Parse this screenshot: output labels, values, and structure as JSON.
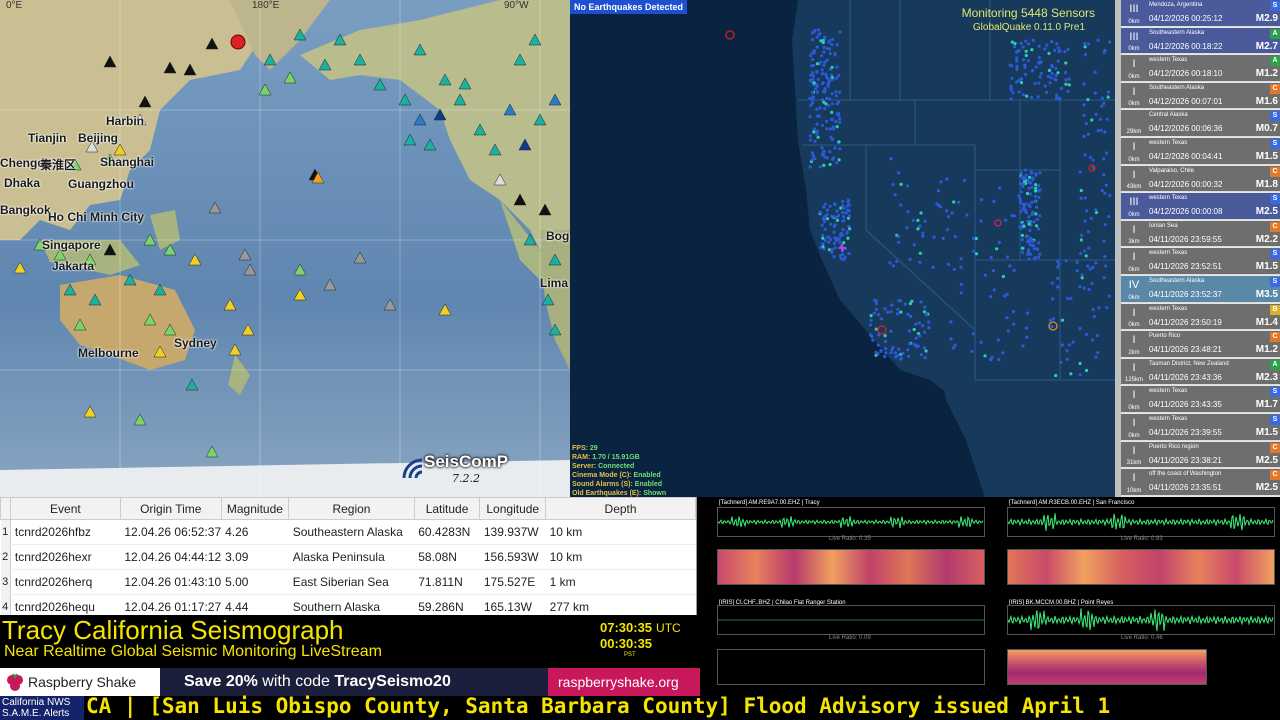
{
  "world_map": {
    "graticule_labels": [
      "0°E",
      "180°E",
      "90°W"
    ],
    "place_labels": [
      {
        "name": "Tianjin"
      },
      {
        "name": "Beijing"
      },
      {
        "name": "Harbin"
      },
      {
        "name": "Shanghai"
      },
      {
        "name": "Chengdu"
      },
      {
        "name": "秦淮区"
      },
      {
        "name": "Dhaka"
      },
      {
        "name": "Guangzhou"
      },
      {
        "name": "Bangkok"
      },
      {
        "name": "Ho Chi Minh City"
      },
      {
        "name": "Singapore"
      },
      {
        "name": "Jakarta"
      },
      {
        "name": "Melbourne"
      },
      {
        "name": "Sydney"
      },
      {
        "name": "Bogotá"
      },
      {
        "name": "Lima"
      }
    ],
    "logo_name": "SeisComP",
    "logo_version": "7.2.2"
  },
  "globalquake": {
    "no_eq_badge": "No Earthquakes Detected",
    "sensors": "Monitoring 5448 Sensors",
    "version": "GlobalQuake 0.11.0 Pre1",
    "status": [
      {
        "k": "FPS:",
        "v": "29"
      },
      {
        "k": "RAM:",
        "v": "1.70 / 15.91GB"
      },
      {
        "k": "Server:",
        "v": "Connected"
      },
      {
        "k": "Cinema Mode (C):",
        "v": "Enabled"
      },
      {
        "k": "Sound Alarms (S):",
        "v": "Enabled"
      },
      {
        "k": "Old Earthquakes (E):",
        "v": "Shown"
      }
    ]
  },
  "quake_list": [
    {
      "intensity": "III",
      "depth": "0km",
      "region": "Mendoza, Argentina",
      "time": "04/12/2026 00:25:12",
      "badge": "S",
      "mag": "M2.9",
      "bg": "#4a5a9a",
      "badge_color": "#3a6ae0"
    },
    {
      "intensity": "III",
      "depth": "0km",
      "region": "Southeastern Alaska",
      "time": "04/12/2026 00:18:22",
      "badge": "A",
      "mag": "M2.7",
      "bg": "#4a5a9a",
      "badge_color": "#2ca04a"
    },
    {
      "intensity": "I",
      "depth": "0km",
      "region": "western Texas",
      "time": "04/12/2026 00:18:10",
      "badge": "A",
      "mag": "M1.2",
      "bg": "#6e6e6e",
      "badge_color": "#2ca04a"
    },
    {
      "intensity": "I",
      "depth": "0km",
      "region": "Southeastern Alaska",
      "time": "04/12/2026 00:07:01",
      "badge": "C",
      "mag": "M1.6",
      "bg": "#6e6e6e",
      "badge_color": "#e07a2a"
    },
    {
      "intensity": "",
      "depth": "29km",
      "region": "Central Alaska",
      "time": "04/12/2026 00:06:36",
      "badge": "S",
      "mag": "M0.7",
      "bg": "#6e6e6e",
      "badge_color": "#3a6ae0"
    },
    {
      "intensity": "I",
      "depth": "0km",
      "region": "western Texas",
      "time": "04/12/2026 00:04:41",
      "badge": "S",
      "mag": "M1.5",
      "bg": "#6e6e6e",
      "badge_color": "#3a6ae0"
    },
    {
      "intensity": "I",
      "depth": "43km",
      "region": "Valparaiso, Chile",
      "time": "04/12/2026 00:00:32",
      "badge": "C",
      "mag": "M1.8",
      "bg": "#6e6e6e",
      "badge_color": "#e07a2a"
    },
    {
      "intensity": "III",
      "depth": "0km",
      "region": "western Texas",
      "time": "04/12/2026 00:00:08",
      "badge": "S",
      "mag": "M2.5",
      "bg": "#4a5a9a",
      "badge_color": "#3a6ae0"
    },
    {
      "intensity": "I",
      "depth": "3km",
      "region": "Ionian Sea",
      "time": "04/11/2026 23:59:55",
      "badge": "C",
      "mag": "M2.2",
      "bg": "#6e6e6e",
      "badge_color": "#e07a2a"
    },
    {
      "intensity": "I",
      "depth": "0km",
      "region": "western Texas",
      "time": "04/11/2026 23:52:51",
      "badge": "S",
      "mag": "M1.5",
      "bg": "#6e6e6e",
      "badge_color": "#3a6ae0"
    },
    {
      "intensity": "IV",
      "depth": "0km",
      "region": "Southeastern Alaska",
      "time": "04/11/2026 23:52:37",
      "badge": "S",
      "mag": "M3.5",
      "bg": "#5a88a8",
      "badge_color": "#3a6ae0"
    },
    {
      "intensity": "I",
      "depth": "0km",
      "region": "western Texas",
      "time": "04/11/2026 23:50:19",
      "badge": "B",
      "mag": "M1.4",
      "bg": "#6e6e6e",
      "badge_color": "#d6b32a"
    },
    {
      "intensity": "I",
      "depth": "2km",
      "region": "Puerto Rico",
      "time": "04/11/2026 23:48:21",
      "badge": "C",
      "mag": "M1.2",
      "bg": "#6e6e6e",
      "badge_color": "#e07a2a"
    },
    {
      "intensity": "I",
      "depth": "125km",
      "region": "Tasman District, New Zealand",
      "time": "04/11/2026 23:43:36",
      "badge": "A",
      "mag": "M2.3",
      "bg": "#6e6e6e",
      "badge_color": "#2ca04a"
    },
    {
      "intensity": "I",
      "depth": "0km",
      "region": "western Texas",
      "time": "04/11/2026 23:43:35",
      "badge": "S",
      "mag": "M1.7",
      "bg": "#6e6e6e",
      "badge_color": "#3a6ae0"
    },
    {
      "intensity": "I",
      "depth": "0km",
      "region": "western Texas",
      "time": "04/11/2026 23:39:55",
      "badge": "S",
      "mag": "M1.5",
      "bg": "#6e6e6e",
      "badge_color": "#3a6ae0"
    },
    {
      "intensity": "I",
      "depth": "31km",
      "region": "Puerto Rico region",
      "time": "04/11/2026 23:38:21",
      "badge": "C",
      "mag": "M2.5",
      "bg": "#6e6e6e",
      "badge_color": "#e07a2a"
    },
    {
      "intensity": "I",
      "depth": "10km",
      "region": "off the coast of Washington",
      "time": "04/11/2026 23:35:51",
      "badge": "C",
      "mag": "M2.5",
      "bg": "#6e6e6e",
      "badge_color": "#e07a2a"
    }
  ],
  "event_table": {
    "headers": [
      "Event",
      "Origin Time",
      "Magnitude",
      "Region",
      "Latitude",
      "Longitude",
      "Depth"
    ],
    "rows": [
      {
        "idx": "1",
        "event": "tcnrd2026hfbz",
        "time": "12.04.26 06:52:37",
        "mag": "4.26",
        "region": "Southeastern Alaska",
        "lat": "60.4283N",
        "lon": "139.937W",
        "depth": "10 km"
      },
      {
        "idx": "2",
        "event": "tcnrd2026hexr",
        "time": "12.04.26 04:44:12",
        "mag": "3.09",
        "region": "Alaska Peninsula",
        "lat": "58.08N",
        "lon": "156.593W",
        "depth": "10 km"
      },
      {
        "idx": "3",
        "event": "tcnrd2026herq",
        "time": "12.04.26 01:43:10",
        "mag": "5.00",
        "region": "East Siberian Sea",
        "lat": "71.811N",
        "lon": "175.527E",
        "depth": "1 km"
      },
      {
        "idx": "4",
        "event": "tcnrd2026hequ",
        "time": "12.04.26 01:17:27",
        "mag": "4.44",
        "region": "Southern Alaska",
        "lat": "59.286N",
        "lon": "165.13W",
        "depth": "277 km"
      }
    ]
  },
  "seismograms": [
    {
      "title": "[Tachnerd] AM.RE9A7.00.EHZ | Tracy",
      "ratio": "Live Ratio: 0.35"
    },
    {
      "title": "[Tachnerd] AM.R3ECB.00.EHZ | San Francisco",
      "ratio": "Live Ratio: 0.83"
    },
    {
      "title": "[IRIS] CI.CHF..BHZ | Chilao Flat Ranger Station",
      "ratio": "Live Ratio: 0.09"
    },
    {
      "title": "[IRIS] BK.MCCM.00.BHZ | Point Reyes",
      "ratio": "Live Ratio: 0.46"
    }
  ],
  "title": {
    "main": "Tracy California Seismograph",
    "sub": "Near Realtime Global Seismic Monitoring LiveStream",
    "utc_time": "07:30:35",
    "utc_label": "UTC",
    "pst_time": "00:30:35",
    "pst_label": "PST"
  },
  "ad": {
    "logo": "Raspberry Shake",
    "promo_prefix": "Save 20%",
    "promo_mid": " with code ",
    "promo_code": "TracySeismo20",
    "url": "raspberryshake.org"
  },
  "alerts": {
    "label_1": "California NWS",
    "label_2": "S.A.M.E. Alerts",
    "ticker": "CA  |  [San Luis Obispo County, Santa Barbara County] Flood Advisory issued April 1"
  },
  "colors": {
    "title_yellow": "#f5e400",
    "ocean": "#6a8fb5",
    "gq_bg": "#0a2340",
    "rs_pink": "#c8185b"
  }
}
